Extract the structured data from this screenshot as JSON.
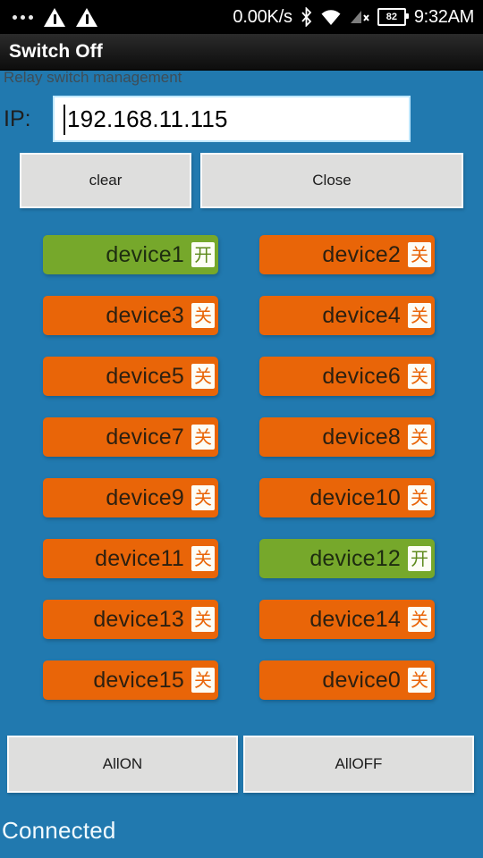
{
  "statusbar": {
    "overflow_icon": "more-dots-icon",
    "warning_icons": [
      "warning-triangle-icon",
      "warning-triangle-icon"
    ],
    "network_speed": "0.00K/s",
    "bluetooth_icon": "bluetooth-icon",
    "wifi_icon": "wifi-icon",
    "signal_icon": "signal-no-service-icon",
    "battery_level": "82",
    "time": "9:32AM"
  },
  "titlebar": {
    "title": "Switch Off"
  },
  "main": {
    "subtitle": "Relay switch management",
    "ip_label": "IP:",
    "ip_value": "192.168.11.115",
    "ip_placeholder": "192.168.11.115",
    "clear_label": "clear",
    "close_label": "Close",
    "allon_label": "AllON",
    "alloff_label": "AllOFF",
    "status": "Connected"
  },
  "colors": {
    "background": "#2179AF",
    "device_on": "#76A82B",
    "device_off": "#E96508",
    "button_face": "#dededd",
    "titlebar": "#1a1a1a"
  },
  "devices": [
    {
      "label": "device1",
      "state": "on",
      "state_glyph": "开"
    },
    {
      "label": "device2",
      "state": "off",
      "state_glyph": "关"
    },
    {
      "label": "device3",
      "state": "off",
      "state_glyph": "关"
    },
    {
      "label": "device4",
      "state": "off",
      "state_glyph": "关"
    },
    {
      "label": "device5",
      "state": "off",
      "state_glyph": "关"
    },
    {
      "label": "device6",
      "state": "off",
      "state_glyph": "关"
    },
    {
      "label": "device7",
      "state": "off",
      "state_glyph": "关"
    },
    {
      "label": "device8",
      "state": "off",
      "state_glyph": "关"
    },
    {
      "label": "device9",
      "state": "off",
      "state_glyph": "关"
    },
    {
      "label": "device10",
      "state": "off",
      "state_glyph": "关"
    },
    {
      "label": "device11",
      "state": "off",
      "state_glyph": "关"
    },
    {
      "label": "device12",
      "state": "on",
      "state_glyph": "开"
    },
    {
      "label": "device13",
      "state": "off",
      "state_glyph": "关"
    },
    {
      "label": "device14",
      "state": "off",
      "state_glyph": "关"
    },
    {
      "label": "device15",
      "state": "off",
      "state_glyph": "关"
    },
    {
      "label": "device0",
      "state": "off",
      "state_glyph": "关"
    }
  ]
}
